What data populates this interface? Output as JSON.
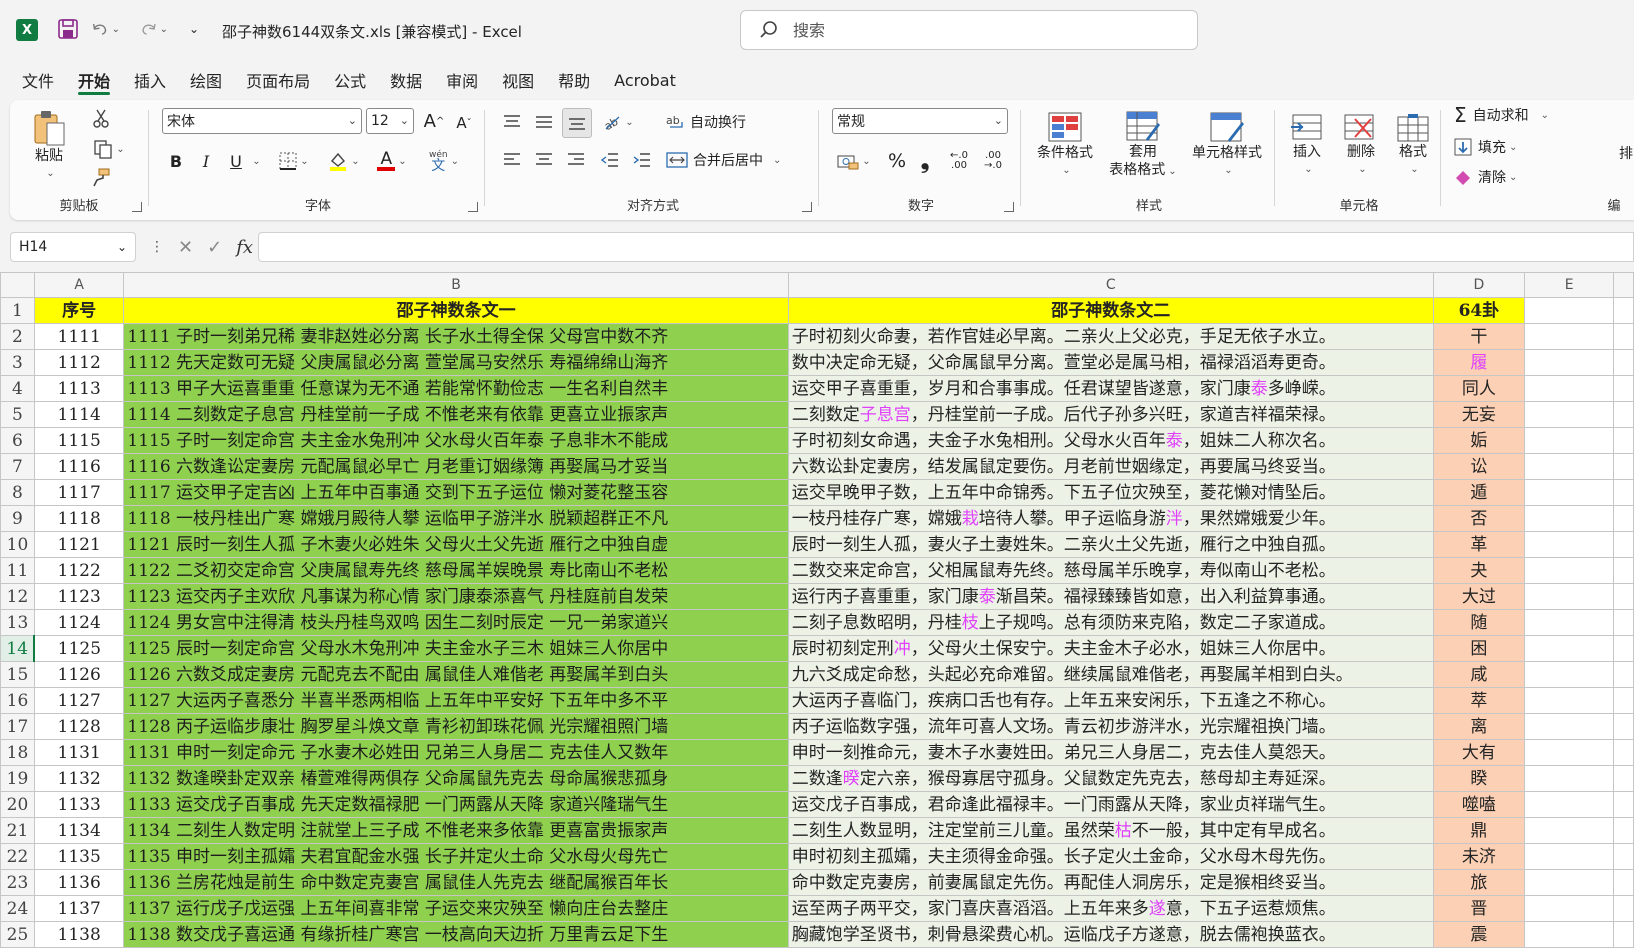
{
  "titlebar": {
    "logo_letter": "X",
    "undo_more": "⌄",
    "redo_more": "⌄",
    "qat_more": "⌄",
    "doc_title": "邵子神数6144双条文.xls  [兼容模式]  -  Excel",
    "search_placeholder": "搜索"
  },
  "menu": [
    "文件",
    "开始",
    "插入",
    "绘图",
    "页面布局",
    "公式",
    "数据",
    "审阅",
    "视图",
    "帮助",
    "Acrobat"
  ],
  "ribbon": {
    "clipboard": {
      "paste": "粘贴",
      "label": "剪贴板"
    },
    "font": {
      "font_name": "宋体",
      "font_size": "12",
      "bold": "B",
      "italic": "I",
      "underline": "U",
      "label": "字体",
      "grow": "A",
      "shrink": "A",
      "wen": "wén",
      "wen_char": "文",
      "color_a": "A"
    },
    "alignment": {
      "wrap": "自动换行",
      "merge": "合并后居中",
      "label": "对齐方式"
    },
    "number": {
      "format": "常规",
      "percent": "%",
      "comma": "❟",
      "label": "数字",
      "inc_decimal": "←.0 .00",
      "dec_decimal": ".00 →.0"
    },
    "styles": {
      "conditional": "条件格式",
      "table1": "套用",
      "table2": "表格格式",
      "cell_style": "单元格样式",
      "label": "样式"
    },
    "cells": {
      "insert": "插入",
      "delete": "删除",
      "format": "格式",
      "label": "单元格"
    },
    "editing": {
      "autosum": "自动求和",
      "fill": "填充",
      "clear": "清除",
      "sort": "排",
      "label": "编"
    }
  },
  "formula_bar": {
    "cell_ref": "H14",
    "fx": "fx",
    "value": ""
  },
  "columns": [
    "A",
    "B",
    "C",
    "D",
    "E"
  ],
  "header_row": {
    "row": "1",
    "a": "序号",
    "b": "邵子神数条文一",
    "c": "邵子神数条文二",
    "d": "64卦"
  },
  "rows": [
    {
      "r": "2",
      "a": "1111",
      "b": "1111  子时一刻弟兄稀  妻非赵姓必分离  长子水土得全保  父母宫中数不齐",
      "c": "子时初刻火命妻，若作官娃必早离。二亲火上父必克，手足无依子水立。",
      "d": "干"
    },
    {
      "r": "3",
      "a": "1112",
      "b": "1112  先天定数可无疑  父庚属鼠必分离  萱堂属马安然乐  寿福绵绵山海齐",
      "c": "数中决定命无疑，父命属鼠早分离。萱堂必是属马相，福禄滔滔寿更奇。",
      "d": "履"
    },
    {
      "r": "4",
      "a": "1113",
      "b": "1113  甲子大运喜重重  任意谋为无不通  若能常怀勤俭志  一生名利自然丰",
      "c": "运交甲子喜重重，岁月和合事事成。任君谋望皆遂意，家门康泰多峥嵘。",
      "d": "同人"
    },
    {
      "r": "5",
      "a": "1114",
      "b": "1114  二刻数定子息宫  丹桂堂前一子成  不惟老来有依靠  更喜立业振家声",
      "c": "二刻数定子息宫，丹桂堂前一子成。后代子孙多兴旺，家道吉祥福荣禄。",
      "d": "无妄"
    },
    {
      "r": "6",
      "a": "1115",
      "b": "1115  子时一刻定命宫  夫主金水兔刑冲  父水母火百年泰  子息非木不能成",
      "c": "子时初刻女命遇，夫金子水兔相刑。父母水火百年泰，姐妹二人称次名。",
      "d": "姤"
    },
    {
      "r": "7",
      "a": "1116",
      "b": "1116  六数逢讼定妻房  元配属鼠必早亡  月老重订姻缘簿  再娶属马才妥当",
      "c": "六数讼卦定妻房，结发属鼠定要伤。月老前世姻缘定，再要属马终妥当。",
      "d": "讼"
    },
    {
      "r": "8",
      "a": "1117",
      "b": "1117  运交甲子定吉凶  上五年中百事通  交到下五子运位  懒对菱花整玉容",
      "c": "运交早晚甲子数，上五年中命锦秀。下五子位灾殃至，菱花懒对情坠后。",
      "d": "遁"
    },
    {
      "r": "9",
      "a": "1118",
      "b": "1118  一枝丹桂出广寒  嫦娥月殿待人攀  运临甲子游泮水  脱颖超群正不凡",
      "c": "一枝丹桂存广寒，嫦娥栽培待人攀。甲子运临身游泮，果然嫦娥爱少年。",
      "d": "否"
    },
    {
      "r": "10",
      "a": "1121",
      "b": "1121  辰时一刻生人孤  子木妻火必姓朱  父母火土父先逝  雁行之中独自虚",
      "c": "辰时一刻生人孤，妻火子土妻姓朱。二亲火土父先逝，雁行之中独自孤。",
      "d": "革"
    },
    {
      "r": "11",
      "a": "1122",
      "b": "1122  二爻初交定命宫  父庚属鼠寿先终  慈母属羊娱晚景  寿比南山不老松",
      "c": "二数交来定命宫，父相属鼠寿先终。慈母属羊乐晚享，寿似南山不老松。",
      "d": "夬"
    },
    {
      "r": "12",
      "a": "1123",
      "b": "1123  运交丙子主欢欣  凡事谋为称心情  家门康泰添喜气  丹桂庭前自发荣",
      "c": "运行丙子喜重重，家门康泰渐昌荣。福禄臻臻皆如意，出入利益算事通。",
      "d": "大过"
    },
    {
      "r": "13",
      "a": "1124",
      "b": "1124  男女宫中注得清  枝头丹桂鸟双鸣  因生二刻时辰定  一兄一弟家道兴",
      "c": "二刻子息数昭明，丹桂枝上子规鸣。总有须防来克陷，数定二子家道成。",
      "d": "随"
    },
    {
      "r": "14",
      "a": "1125",
      "b": "1125  辰时一刻定命宫  父母水木兔刑冲  夫主金水子三木  姐妹三人你居中",
      "c": "辰时初刻定刑冲，父母火土保安宁。夫主金木子必水，姐妹三人你居中。",
      "d": "困"
    },
    {
      "r": "15",
      "a": "1126",
      "b": "1126  六数爻成定妻房  元配克去不配由  属鼠佳人难偕老  再娶属羊到白头",
      "c": "九六爻成定命愁，头起必充命难留。继续属鼠难偕老，再娶属羊相到白头。",
      "d": "咸"
    },
    {
      "r": "16",
      "a": "1127",
      "b": "1127  大运丙子喜悉分  半喜半悉两相临  上五年中平安好  下五年中多不平",
      "c": "大运丙子喜临门，疾病口舌也有存。上年五来安闲乐，下五逢之不称心。",
      "d": "萃"
    },
    {
      "r": "17",
      "a": "1128",
      "b": "1128  丙子运临步康壮  胸罗星斗焕文章  青衫初卸珠花佩  光宗耀祖照门墙",
      "c": "丙子运临数字强，流年可喜人文场。青云初步游泮水，光宗耀祖换门墙。",
      "d": "离"
    },
    {
      "r": "18",
      "a": "1131",
      "b": "1131  申时一刻定命元  子水妻木必姓田  兄弟三人身居二  克去佳人又数年",
      "c": "申时一刻推命元，妻木子水妻姓田。弟兄三人身居二，克去佳人莫怨天。",
      "d": "大有"
    },
    {
      "r": "19",
      "a": "1132",
      "b": "1132  数逢暌卦定双亲  椿萱难得两俱存  父命属鼠先克去  母命属猴悲孤身",
      "c": "二数逢暌定六亲，猴母寡居守孤身。父鼠数定先克去，慈母却主寿延深。",
      "d": "睽"
    },
    {
      "r": "20",
      "a": "1133",
      "b": "1133  运交戊子百事成  先天定数福禄肥  一门两露从天降  家道兴隆瑞气生",
      "c": "运交戊子百事成，君命逢此福禄丰。一门雨露从天降，家业贞祥瑞气生。",
      "d": "噬嗑"
    },
    {
      "r": "21",
      "a": "1134",
      "b": "1134  二刻生人数定明  注就堂上三子成  不惟老来多依靠  更喜富贵振家声",
      "c": "二刻生人数显明，注定堂前三儿童。虽然荣枯不一般，其中定有早成名。",
      "d": "鼎"
    },
    {
      "r": "22",
      "a": "1135",
      "b": "1135  申时一刻主孤孀  夫君宜配金水强  长子并定火土命  父水母火母先亡",
      "c": "申时初刻主孤孀，夫主须得金命强。长子定火土金命，父水母木母先伤。",
      "d": "未济"
    },
    {
      "r": "23",
      "a": "1136",
      "b": "1136  兰房花烛是前生  命中数定克妻宫  属鼠佳人先克去  继配属猴百年长",
      "c": "命中数定克妻房，前妻属鼠定先伤。再配佳人洞房乐，定是猴相终妥当。",
      "d": "旅"
    },
    {
      "r": "24",
      "a": "1137",
      "b": "1137  运行戊子戊运强  上五年间喜非常  子运交来灾殃至  懒向庄台去整庄",
      "c": "运至两子两平交，家门喜庆喜滔滔。上五年来多遂意，下五子运惹烦焦。",
      "d": "晋"
    },
    {
      "r": "25",
      "a": "1138",
      "b": "1138  数交戊子喜运通  有缘折桂广寒宫  一枝高向天边折  万里青云足下生",
      "c": "胸藏饱学圣贤书，刺骨悬梁费心机。运临戊子方遂意，脱去儒袍换蓝衣。",
      "d": "震"
    }
  ],
  "pink_chars": {
    "3": "履",
    "5c": "子息宫",
    "6c": "泰",
    "4c": "泰",
    "9c": "栽",
    "9c2": "泮",
    "12c": "泰",
    "13c": "枝",
    "14c": "冲",
    "19c": "暌",
    "21c": "枯",
    "24c": "遂"
  },
  "selected_row": "14",
  "colors": {
    "accent": "#107c41",
    "col_b": "#8fd14f",
    "col_c": "#ecf2e6",
    "col_d": "#fbd0b4",
    "header": "#ffff00",
    "pink": "#e040fb"
  }
}
